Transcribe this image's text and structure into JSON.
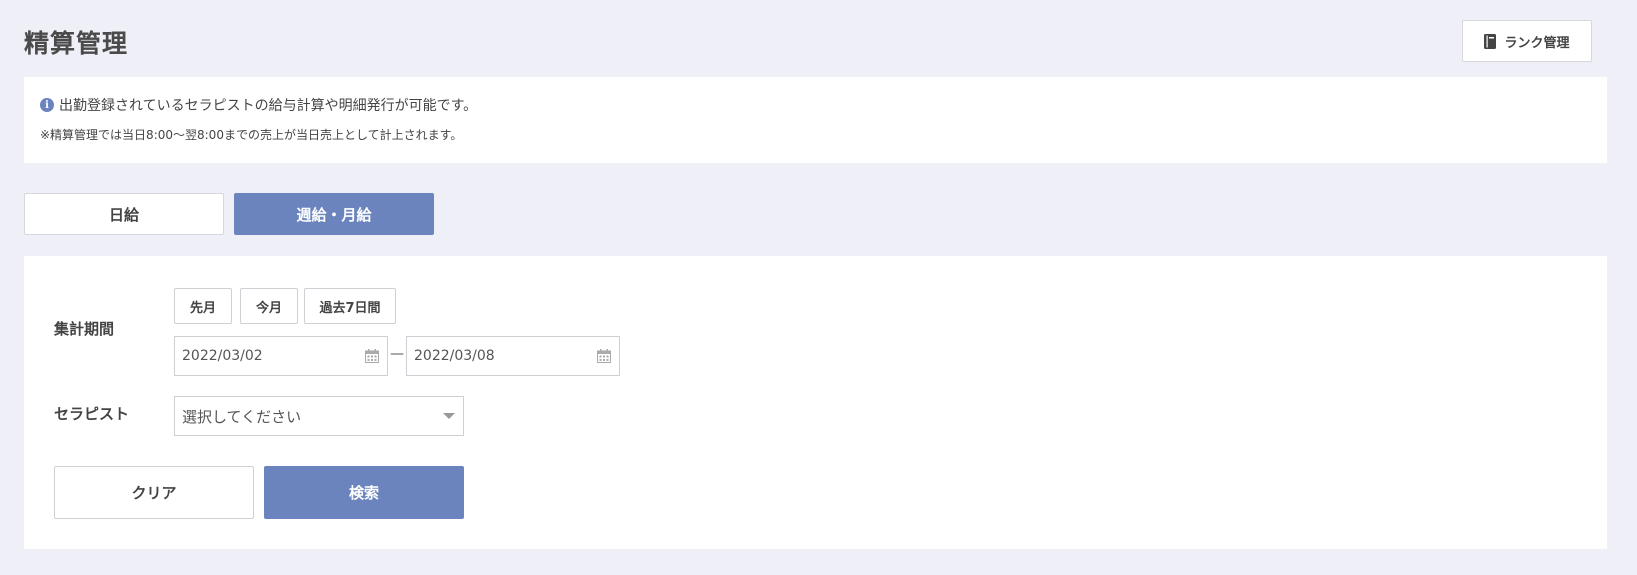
{
  "page": {
    "title": "精算管理"
  },
  "header": {
    "rank_button_label": "ランク管理"
  },
  "info": {
    "icon": "info-icon",
    "main_text": "出勤登録されているセラピストの給与計算や明細発行が可能です。",
    "note_text": "※精算管理では当日8:00〜翌8:00までの売上が当日売上として計上されます。"
  },
  "tabs": [
    {
      "label": "日給",
      "active": false
    },
    {
      "label": "週給・月給",
      "active": true
    }
  ],
  "form": {
    "period_label": "集計期間",
    "quick_ranges": [
      "先月",
      "今月",
      "過去7日間"
    ],
    "start_date": "2022/03/02",
    "end_date": "2022/03/08",
    "range_separator": "—",
    "therapist_label": "セラピスト",
    "therapist_placeholder": "選択してください",
    "clear_label": "クリア",
    "search_label": "検索"
  },
  "colors": {
    "accent": "#6b84bd",
    "background": "#eeeff7"
  }
}
